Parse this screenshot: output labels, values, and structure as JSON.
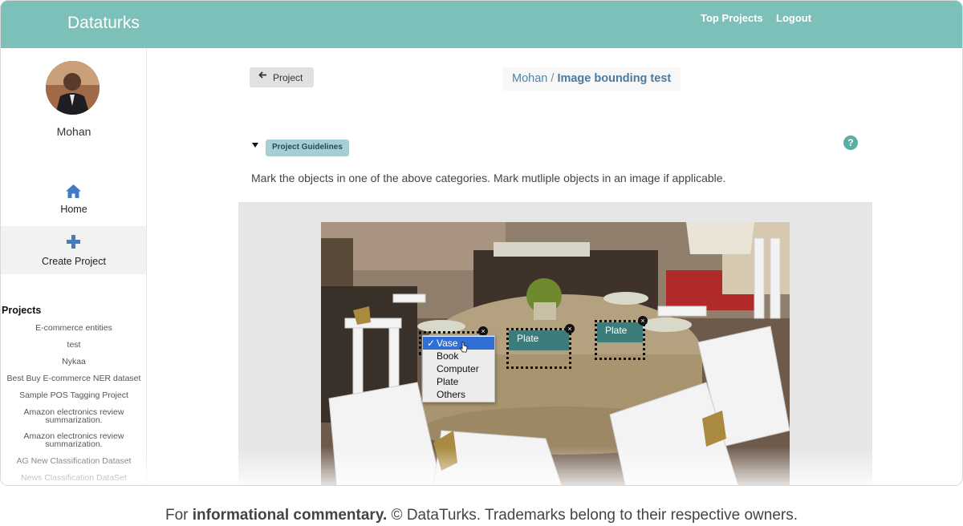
{
  "header": {
    "brand": "Dataturks",
    "links": [
      "Top Projects",
      "Logout"
    ],
    "bar_color": "#7cc0b9"
  },
  "sidebar": {
    "user_name": "Mohan",
    "nav": [
      {
        "label": "Home",
        "icon": "home-icon"
      },
      {
        "label": "Create Project",
        "icon": "plus-icon"
      }
    ],
    "projects_heading": "Projects",
    "projects": [
      "E-commerce entities",
      "test",
      "Nykaa",
      "Best Buy E-commerce NER dataset",
      "Sample POS Tagging Project",
      "Amazon electronics review summarization.",
      "Amazon electronics review summarization.",
      "AG New Classification Dataset",
      "News Classification DataSet"
    ]
  },
  "toolbar": {
    "back_label": "Project",
    "back_icon": "arrow-left-icon"
  },
  "breadcrumb": {
    "user": "Mohan",
    "separator": "/",
    "project": "Image bounding test"
  },
  "guidelines": {
    "badge": "Project Guidelines",
    "text": "Mark the objects in one of the above categories. Mark mutliple objects in an image if applicable.",
    "help_icon": "question-circle-icon"
  },
  "annotator": {
    "labels": [
      "Vase",
      "Book",
      "Computer",
      "Plate",
      "Others"
    ],
    "selected_label": "Vase",
    "check_mark": "✓",
    "boxes": [
      {
        "label": "Plate"
      },
      {
        "label": "Plate"
      }
    ],
    "close_glyph": "×",
    "box_label_color": "#3c7c7a"
  },
  "footer_caption": {
    "prefix": "For ",
    "bold": "informational commentary.",
    "suffix": " © DataTurks. Trademarks belong to their respective owners."
  }
}
